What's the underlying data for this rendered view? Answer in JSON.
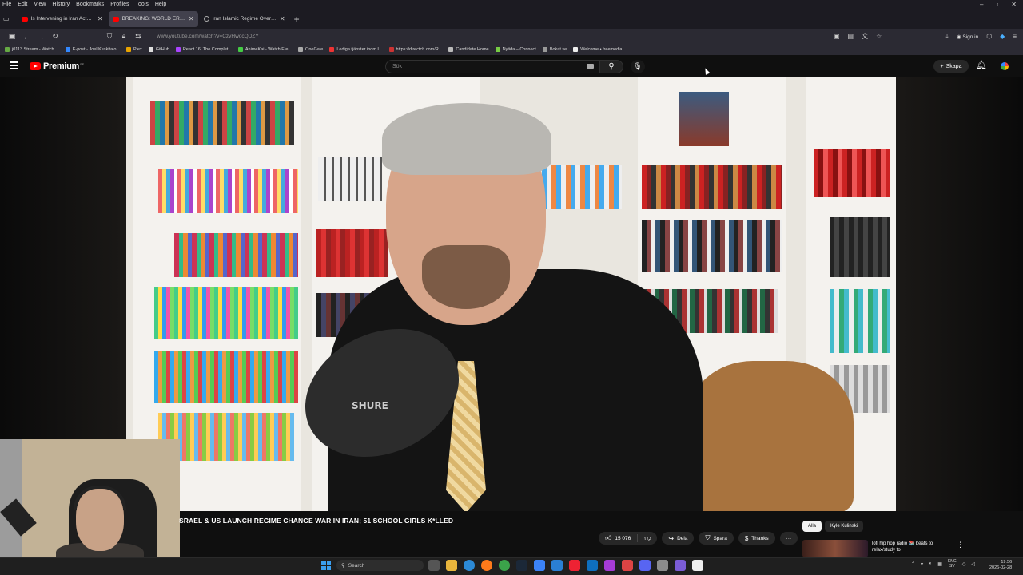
{
  "menu": [
    "File",
    "Edit",
    "View",
    "History",
    "Bookmarks",
    "Profiles",
    "Tools",
    "Help"
  ],
  "window_controls": {
    "minimize": "–",
    "restore": "▫",
    "close": "✕"
  },
  "tabs": [
    {
      "title": "Is Intervening in Iran Actually A...",
      "active": false,
      "favicon": "youtube-icon"
    },
    {
      "title": "BREAKING: WORLD ERUPTS AS...",
      "active": true,
      "favicon": "youtube-icon"
    },
    {
      "title": "Iran Islamic Regime Overview",
      "active": false,
      "favicon": "globe-icon"
    }
  ],
  "new_tab": "+",
  "address_bar": {
    "url": "www.youtube.com/watch?v=CzvHwocQDZY"
  },
  "sign_in": "Sign in",
  "bookmarks": [
    "j0113 Stream - Watch ...",
    "E-post - Joel Keskitalo...",
    "Plex",
    "GitHub",
    "React 16: The Complet...",
    "AnimeKai - Watch Fre...",
    "OneGate",
    "Lediga tjänster inom I...",
    "https://directch.com/R...",
    "Candidate Home",
    "Nytida – Connect",
    "Bokat.se",
    "Welcome • freemedia..."
  ],
  "youtube": {
    "logo_text": "Premium",
    "logo_sup": "SE",
    "search_placeholder": "Sök",
    "create_label": "Skapa"
  },
  "video": {
    "title": "SRAEL & US LAUNCH REGIME CHANGE WAR IN IRAN; 51 SCHOOL GIRLS K*LLED",
    "likes": "15 076",
    "share": "Dela",
    "save": "Spara",
    "thanks": "Thanks",
    "more": "···",
    "mic_brand": "SHURE"
  },
  "chips": [
    "Alla",
    "Kyle Kulinski"
  ],
  "recommendation": {
    "title": "lofi hip hop radio 📚 beats to relax/study to",
    "more": "⋮"
  },
  "taskbar": {
    "search": "Search"
  },
  "tray": {
    "lang_top": "ENG",
    "lang_bottom": "SV",
    "time": "19:56",
    "date": "2026-02-28"
  },
  "colors": {
    "yt_red": "#ff0000",
    "bg": "#0f0f0f",
    "tab_active": "#42414d",
    "toolbar": "#2b2a33"
  }
}
